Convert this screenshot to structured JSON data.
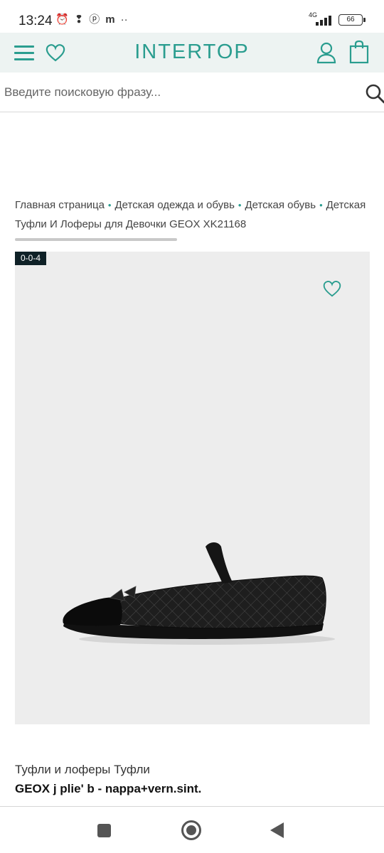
{
  "status_bar": {
    "time": "13:24",
    "network": "4G",
    "battery": "66"
  },
  "header": {
    "logo": "INTERTOP",
    "menu_icon": "hamburger-menu-icon",
    "wishlist_icon": "heart-outline-icon",
    "account_icon": "user-icon",
    "cart_icon": "shopping-bag-icon",
    "accent_color": "#2a9d8f",
    "background_color": "#edf3f2"
  },
  "search": {
    "placeholder": "Введите поисковую фразу...",
    "icon": "search-icon"
  },
  "breadcrumb": {
    "items": [
      "Главная страница",
      "Детская одежда и обувь",
      "Детская обувь",
      "Детская"
    ],
    "separator": "•",
    "current": "Туфли И Лоферы для Девочки GEOX XK21168"
  },
  "product": {
    "sku_badge": "0-0-4",
    "category": "Туфли и лоферы Туфли",
    "name": "GEOX j plie' b - nappa+vern.sint.",
    "image_background": "#ededed",
    "wishlist_icon": "heart-outline-icon"
  },
  "nav_bar": {
    "recents_icon": "square-icon",
    "home_icon": "circle-home-icon",
    "back_icon": "triangle-back-icon"
  }
}
